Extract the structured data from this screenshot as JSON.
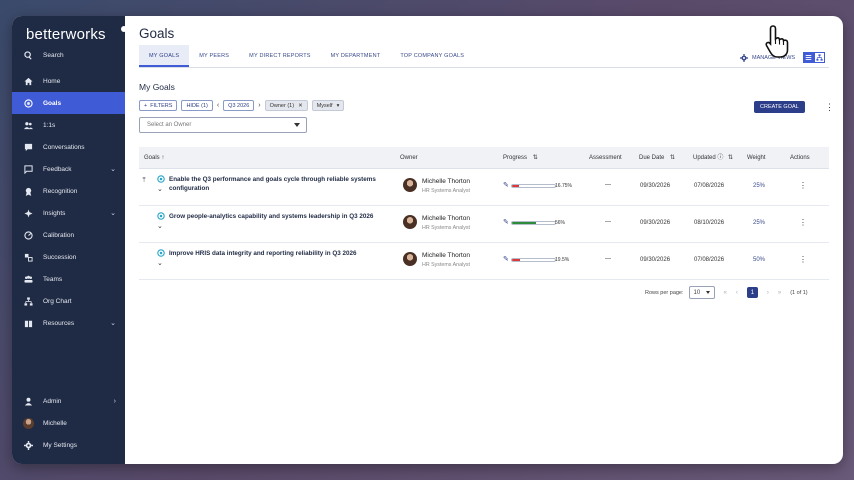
{
  "brand": {
    "logo": "betterworks"
  },
  "sidebar": {
    "items": [
      {
        "label": "Search",
        "icon": "search-icon"
      },
      {
        "label": "Home",
        "icon": "home-icon"
      },
      {
        "label": "Goals",
        "icon": "goals-icon",
        "active": true
      },
      {
        "label": "1:1s",
        "icon": "people-icon"
      },
      {
        "label": "Conversations",
        "icon": "chat-icon"
      },
      {
        "label": "Feedback",
        "icon": "feedback-icon",
        "chevron": "⌄"
      },
      {
        "label": "Recognition",
        "icon": "recognition-icon"
      },
      {
        "label": "Insights",
        "icon": "insights-icon",
        "chevron": "⌄"
      },
      {
        "label": "Calibration",
        "icon": "calibration-icon"
      },
      {
        "label": "Succession",
        "icon": "succession-icon"
      },
      {
        "label": "Teams",
        "icon": "teams-icon"
      },
      {
        "label": "Org Chart",
        "icon": "org-chart-icon"
      },
      {
        "label": "Resources",
        "icon": "resources-icon",
        "chevron": "⌄"
      }
    ],
    "bottom": [
      {
        "label": "Admin",
        "icon": "admin-icon",
        "chevron": "›"
      },
      {
        "label": "Michelle",
        "icon": "avatar"
      },
      {
        "label": "My Settings",
        "icon": "gear-icon"
      }
    ]
  },
  "header": {
    "title": "Goals",
    "tabs": [
      "MY GOALS",
      "MY PEERS",
      "MY DIRECT REPORTS",
      "MY DEPARTMENT",
      "TOP COMPANY GOALS"
    ],
    "manage_views": "MANAGE VIEWS"
  },
  "content": {
    "section_title": "My Goals",
    "filters_label": "FILTERS",
    "hide_label": "HIDE (1)",
    "period": "Q3 2026",
    "owner_chip": "Owner (1)",
    "owner_value": "Myself",
    "owner_placeholder": "Select an Owner",
    "create_goal": "CREATE GOAL"
  },
  "table": {
    "headers": {
      "goals": "Goals",
      "owner": "Owner",
      "progress": "Progress",
      "assessment": "Assessment",
      "due_date": "Due Date",
      "updated": "Updated",
      "weight": "Weight",
      "actions": "Actions"
    },
    "rows": [
      {
        "title": "Enable the Q3 performance and goals cycle through reliable systems configuration",
        "owner": "Michelle Thorton",
        "role": "HR Systems Analyst",
        "progress": 16.75,
        "progress_label": "16.75%",
        "progress_color": "#d93a3a",
        "assessment": "—",
        "due": "09/30/2026",
        "updated": "07/08/2026",
        "weight": "25%"
      },
      {
        "title": "Grow people-analytics capability and systems leadership in Q3 2026",
        "owner": "Michelle Thorton",
        "role": "HR Systems Analyst",
        "progress": 56,
        "progress_label": "56%",
        "progress_color": "#2e8b3a",
        "assessment": "—",
        "due": "09/30/2026",
        "updated": "08/10/2026",
        "weight": "25%"
      },
      {
        "title": "Improve HRIS data integrity and reporting reliability in Q3 2026",
        "owner": "Michelle Thorton",
        "role": "HR Systems Analyst",
        "progress": 19.5,
        "progress_label": "19.5%",
        "progress_color": "#d93a3a",
        "assessment": "—",
        "due": "09/30/2026",
        "updated": "07/08/2026",
        "weight": "50%"
      }
    ]
  },
  "pagination": {
    "rows_per_page_label": "Rows per page:",
    "rows_per_page": "10",
    "current_page": "1",
    "summary": "(1 of 1)"
  }
}
